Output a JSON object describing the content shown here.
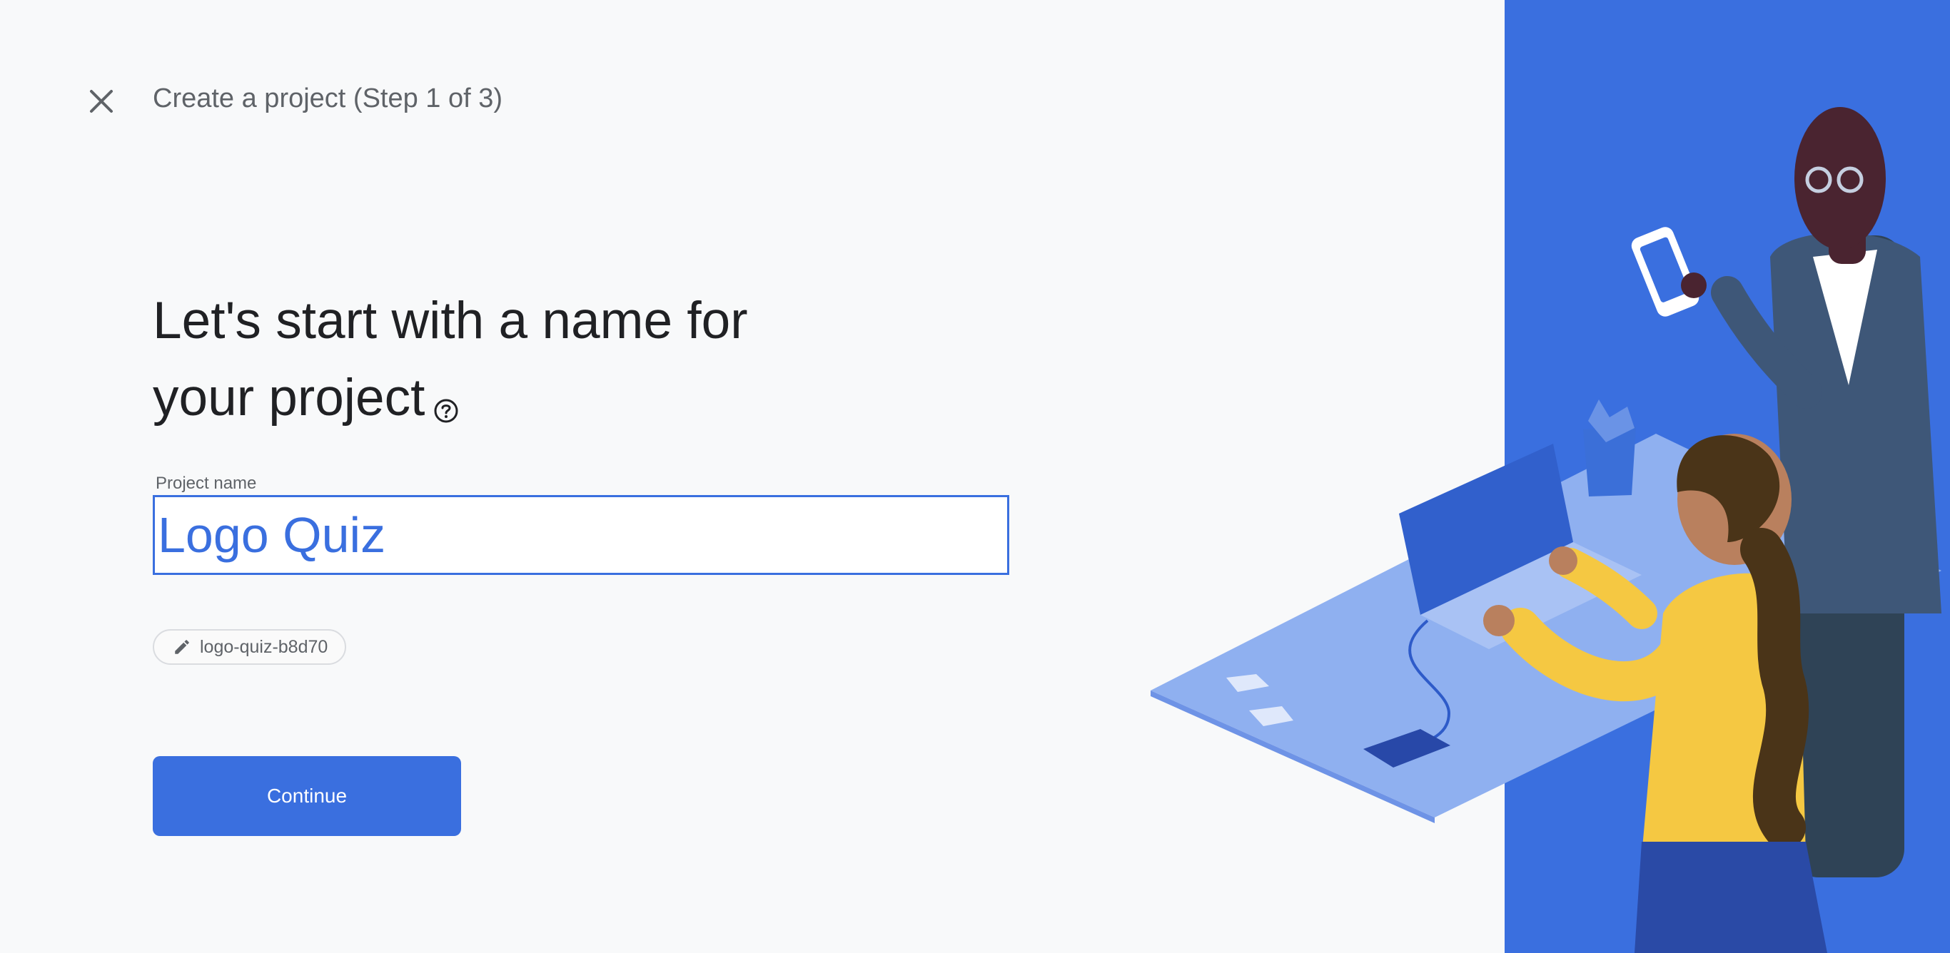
{
  "header": {
    "close_icon": "close-icon",
    "title": "Create a project (Step 1 of 3)"
  },
  "main": {
    "headline_line1": "Let's start with a name for",
    "headline_line2": "your project",
    "help_icon": "help-circle-icon",
    "project_name_label": "Project name",
    "project_name_value": "Logo Quiz",
    "project_id_chip": {
      "icon": "pencil-icon",
      "label": "logo-quiz-b8d70"
    },
    "continue_label": "Continue"
  },
  "colors": {
    "accent": "#3a6fdf",
    "background": "#f8f9fa",
    "illustration_panel": "#3a6fdf"
  }
}
